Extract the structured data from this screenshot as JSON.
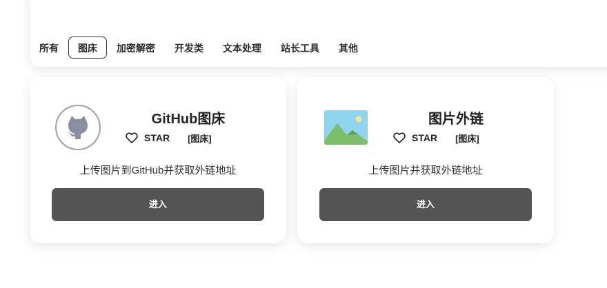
{
  "filter": {
    "tabs": [
      "所有",
      "图床",
      "加密解密",
      "开发类",
      "文本处理",
      "站长工具",
      "其他"
    ],
    "active": "图床"
  },
  "cards": [
    {
      "title": "GitHub图床",
      "star_label": "STAR",
      "tag": "[图床]",
      "description": "上传图片到GitHub并获取外链地址",
      "button_label": "进入",
      "icon": "github-logo"
    },
    {
      "title": "图片外链",
      "star_label": "STAR",
      "tag": "[图床]",
      "description": "上传图片并获取外链地址",
      "button_label": "进入",
      "icon": "image-landscape"
    }
  ],
  "colors": {
    "button_bg": "#545454",
    "card_bg": "#ffffff",
    "logo_gray": "#8a8fa0",
    "image_sky": "#8fd3ef",
    "image_hill": "#7cbf6a",
    "image_sun": "#f6e58a"
  }
}
